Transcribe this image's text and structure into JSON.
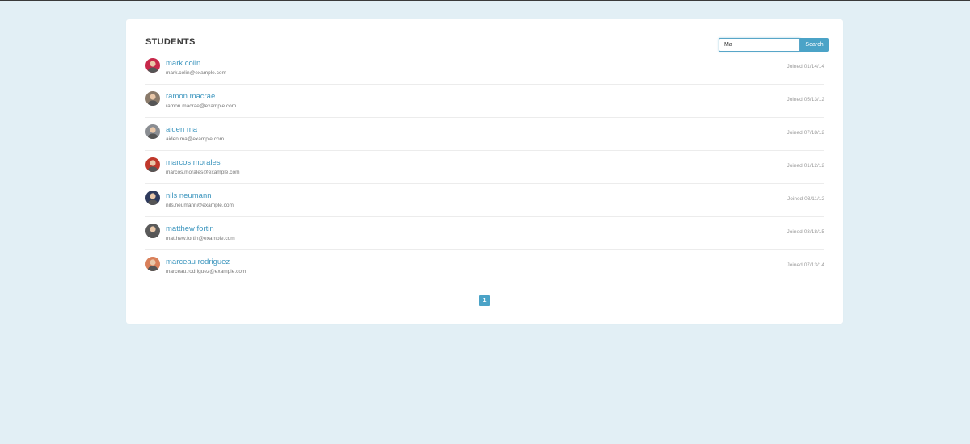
{
  "card": {
    "title": "STUDENTS"
  },
  "search": {
    "value": "Ma",
    "button_label": "Search"
  },
  "students": [
    {
      "name": "mark colin",
      "email": "mark.colin@example.com",
      "joined_label": "Joined",
      "joined_date": "01/14/14",
      "avatar_color": "#c7284a"
    },
    {
      "name": "ramon macrae",
      "email": "ramon.macrae@example.com",
      "joined_label": "Joined",
      "joined_date": "05/13/12",
      "avatar_color": "#8a7a6a"
    },
    {
      "name": "aiden ma",
      "email": "aiden.ma@example.com",
      "joined_label": "Joined",
      "joined_date": "07/18/12",
      "avatar_color": "#8a8d92"
    },
    {
      "name": "marcos morales",
      "email": "marcos.morales@example.com",
      "joined_label": "Joined",
      "joined_date": "01/12/12",
      "avatar_color": "#c0382b"
    },
    {
      "name": "nils neumann",
      "email": "nils.neumann@example.com",
      "joined_label": "Joined",
      "joined_date": "03/11/12",
      "avatar_color": "#2e3a5c"
    },
    {
      "name": "matthew fortin",
      "email": "matthew.fortin@example.com",
      "joined_label": "Joined",
      "joined_date": "03/18/15",
      "avatar_color": "#5a5a5a"
    },
    {
      "name": "marceau rodriguez",
      "email": "marceau.rodriguez@example.com",
      "joined_label": "Joined",
      "joined_date": "07/13/14",
      "avatar_color": "#d9805a"
    }
  ],
  "pagination": {
    "current_page": "1"
  },
  "colors": {
    "background": "#e2eff5",
    "accent": "#4ba3c7",
    "link": "#3f97bf"
  }
}
